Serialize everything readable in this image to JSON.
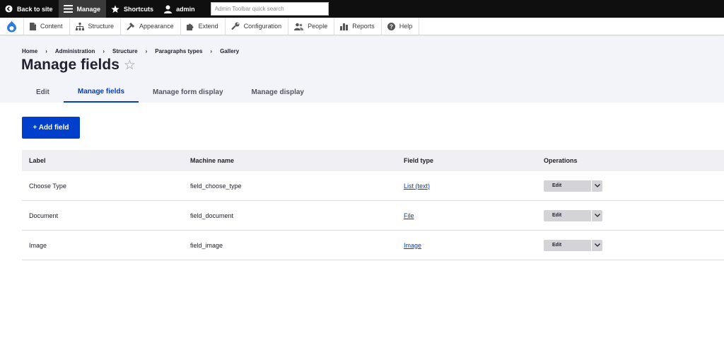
{
  "toolbar": {
    "back_to_site": "Back to site",
    "manage": "Manage",
    "shortcuts": "Shortcuts",
    "user": "admin",
    "search_placeholder": "Admin Toolbar quick search"
  },
  "menu": {
    "items": [
      {
        "label": "Content",
        "icon": "content-icon"
      },
      {
        "label": "Structure",
        "icon": "structure-icon"
      },
      {
        "label": "Appearance",
        "icon": "appearance-icon"
      },
      {
        "label": "Extend",
        "icon": "extend-icon"
      },
      {
        "label": "Configuration",
        "icon": "wrench-icon"
      },
      {
        "label": "People",
        "icon": "people-icon"
      },
      {
        "label": "Reports",
        "icon": "reports-icon"
      },
      {
        "label": "Help",
        "icon": "help-icon"
      }
    ]
  },
  "breadcrumb": [
    "Home",
    "Administration",
    "Structure",
    "Paragraphs types",
    "Gallery"
  ],
  "page": {
    "title": "Manage fields",
    "star": "☆"
  },
  "tabs": [
    "Edit",
    "Manage fields",
    "Manage form display",
    "Manage display"
  ],
  "actions": {
    "add_field": "+ Add field"
  },
  "table": {
    "headers": [
      "Label",
      "Machine name",
      "Field type",
      "Operations"
    ],
    "rows": [
      {
        "label": "Choose Type",
        "machine": "field_choose_type",
        "type": "List (text)",
        "op": "Edit"
      },
      {
        "label": "Document",
        "machine": "field_document",
        "type": "File",
        "op": "Edit"
      },
      {
        "label": "Image",
        "machine": "field_image",
        "type": "Image",
        "op": "Edit"
      }
    ]
  },
  "colors": {
    "accent": "#003ecc",
    "toolbar_bg": "#0f0f0f",
    "header_bg": "#f3f4f9"
  }
}
